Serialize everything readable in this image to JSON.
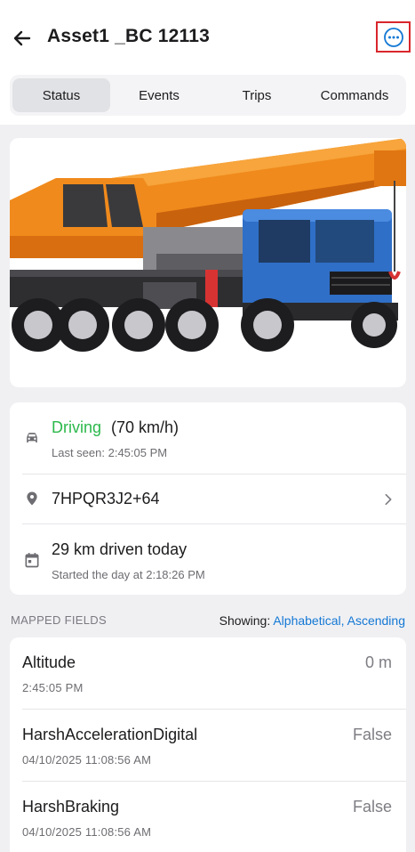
{
  "header": {
    "title": "Asset1 _BC 12113",
    "back_icon": "arrow-left-icon",
    "more_icon": "more-horizontal-icon"
  },
  "tabs": [
    {
      "label": "Status",
      "active": true
    },
    {
      "label": "Events",
      "active": false
    },
    {
      "label": "Trips",
      "active": false
    },
    {
      "label": "Commands",
      "active": false
    }
  ],
  "status": {
    "state": "Driving",
    "speed": "(70 km/h)",
    "last_seen": "Last seen: 2:45:05 PM",
    "location": "7HPQR3J2+64",
    "distance": "29 km driven today",
    "started": "Started the day at 2:18:26 PM",
    "state_color": "#2cb84b"
  },
  "mapped": {
    "title": "MAPPED FIELDS",
    "showing_label": "Showing:",
    "sort": "Alphabetical, Ascending",
    "fields": [
      {
        "name": "Altitude",
        "value": "0 m",
        "time": "2:45:05 PM"
      },
      {
        "name": "HarshAccelerationDigital",
        "value": "False",
        "time": "04/10/2025 11:08:56 AM"
      },
      {
        "name": "HarshBraking",
        "value": "False",
        "time": "04/10/2025 11:08:56 AM"
      }
    ]
  },
  "colors": {
    "accent": "#1478d4",
    "highlight_border": "#d9262c"
  }
}
